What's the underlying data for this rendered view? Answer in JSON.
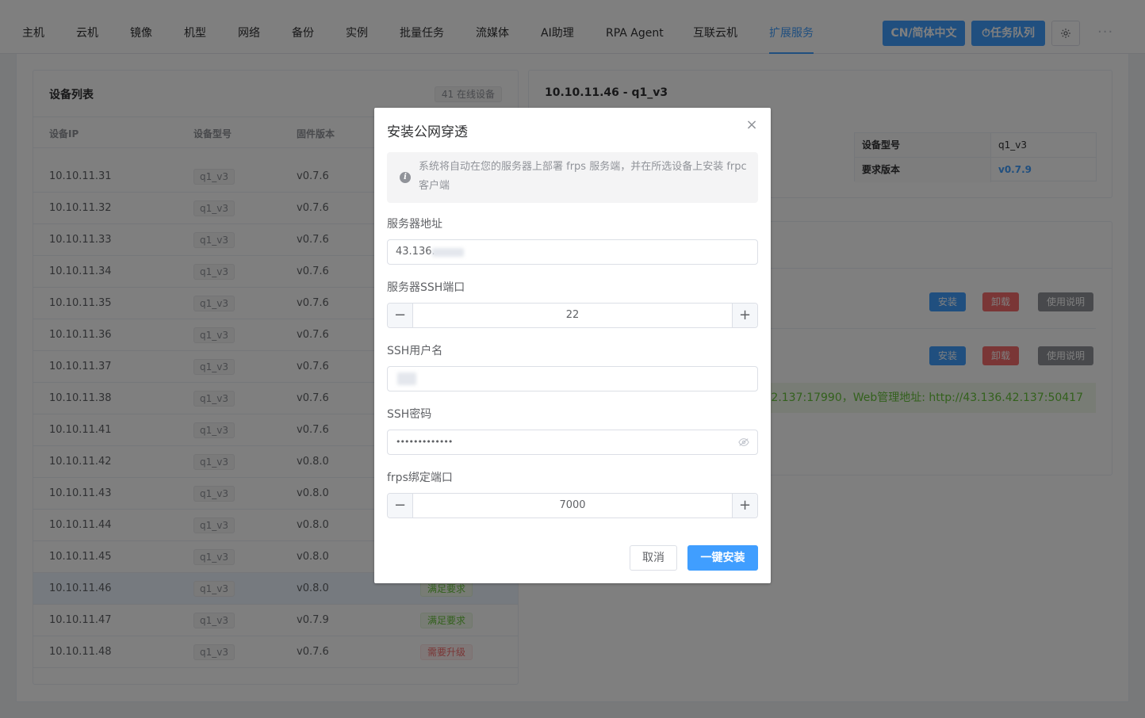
{
  "nav": {
    "tabs": [
      "主机",
      "云机",
      "镜像",
      "机型",
      "网络",
      "备份",
      "实例",
      "批量任务",
      "流媒体",
      "AI助理",
      "RPA Agent",
      "互联云机",
      "扩展服务"
    ],
    "active_tab": "扩展服务",
    "language_button": "CN/简体中文",
    "task_queue_button": "⏱任务队列",
    "more": "···"
  },
  "device_list": {
    "title": "设备列表",
    "online_badge": "41 在线设备",
    "columns": [
      "设备IP",
      "设备型号",
      "固件版本"
    ],
    "rows": [
      {
        "ip": "10.10.11.31",
        "model": "q1_v3",
        "firmware": "v0.7.6",
        "status": ""
      },
      {
        "ip": "10.10.11.32",
        "model": "q1_v3",
        "firmware": "v0.7.6",
        "status": ""
      },
      {
        "ip": "10.10.11.33",
        "model": "q1_v3",
        "firmware": "v0.7.6",
        "status": ""
      },
      {
        "ip": "10.10.11.34",
        "model": "q1_v3",
        "firmware": "v0.7.6",
        "status": ""
      },
      {
        "ip": "10.10.11.35",
        "model": "q1_v3",
        "firmware": "v0.7.6",
        "status": ""
      },
      {
        "ip": "10.10.11.36",
        "model": "q1_v3",
        "firmware": "v0.7.6",
        "status": ""
      },
      {
        "ip": "10.10.11.37",
        "model": "q1_v3",
        "firmware": "v0.7.6",
        "status": ""
      },
      {
        "ip": "10.10.11.38",
        "model": "q1_v3",
        "firmware": "v0.7.6",
        "status": ""
      },
      {
        "ip": "10.10.11.41",
        "model": "q1_v3",
        "firmware": "v0.7.6",
        "status": ""
      },
      {
        "ip": "10.10.11.42",
        "model": "q1_v3",
        "firmware": "v0.8.0",
        "status": ""
      },
      {
        "ip": "10.10.11.43",
        "model": "q1_v3",
        "firmware": "v0.8.0",
        "status": ""
      },
      {
        "ip": "10.10.11.44",
        "model": "q1_v3",
        "firmware": "v0.8.0",
        "status": ""
      },
      {
        "ip": "10.10.11.45",
        "model": "q1_v3",
        "firmware": "v0.8.0",
        "status": ""
      },
      {
        "ip": "10.10.11.46",
        "model": "q1_v3",
        "firmware": "v0.8.0",
        "status": "满足要求"
      },
      {
        "ip": "10.10.11.47",
        "model": "q1_v3",
        "firmware": "v0.7.9",
        "status": "满足要求"
      },
      {
        "ip": "10.10.11.48",
        "model": "q1_v3",
        "firmware": "v0.7.6",
        "status": "需要升级"
      }
    ],
    "selected_ip": "10.10.11.46"
  },
  "detail": {
    "title": "10.10.11.46 - q1_v3",
    "model_label": "设备型号",
    "model_value": "q1_v3",
    "required_label": "要求版本",
    "required_value": "v0.7.9"
  },
  "extensions": {
    "install": "安装",
    "uninstall": "卸载",
    "guide": "使用说明",
    "info": "36.42.137:17990，Web管理地址: http://43.136.42.137:50417"
  },
  "dialog": {
    "title": "安装公网穿透",
    "notice": "系统将自动在您的服务器上部署 frps 服务端，并在所选设备上安装 frpc 客户端",
    "server_label": "服务器地址",
    "server_value": "43.136.",
    "ssh_port_label": "服务器SSH端口",
    "ssh_port_value": "22",
    "ssh_user_label": "SSH用户名",
    "ssh_pass_label": "SSH密码",
    "ssh_pass_value": "•••••••••••••",
    "frps_port_label": "frps绑定端口",
    "frps_port_value": "7000",
    "cancel": "取消",
    "confirm": "一键安装",
    "minus": "−",
    "plus": "+",
    "close": "×"
  },
  "colors": {
    "primary": "#409eff",
    "success": "#67c23a",
    "danger": "#f56c6c",
    "info": "#909399"
  }
}
